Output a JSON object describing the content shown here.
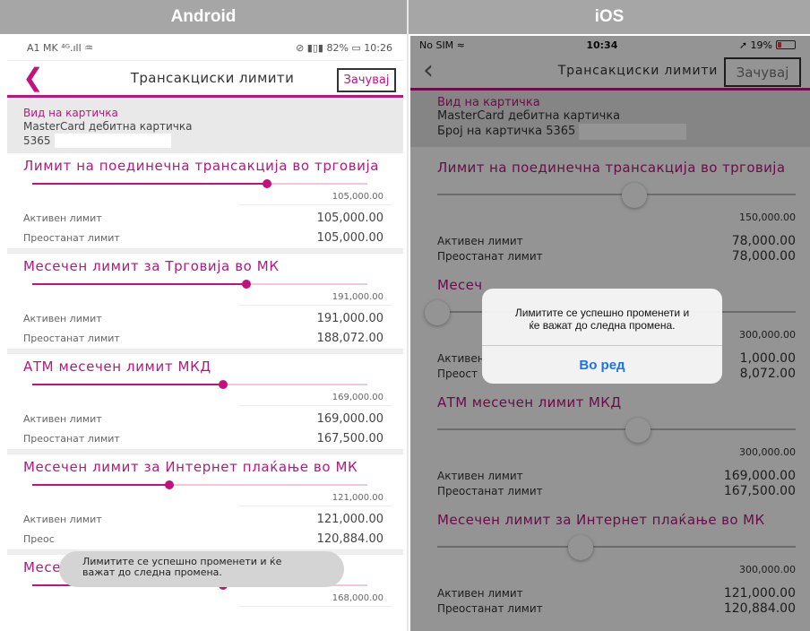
{
  "labels": {
    "android": "Android",
    "ios": "iOS"
  },
  "colors": {
    "accent": "#c2127f",
    "header_bg": "#a6a6a6",
    "ios_link": "#1a73e8"
  },
  "android": {
    "status": {
      "left": "A1 MK ⁴ᴳ.ıll ♒",
      "right": "⊘ ▮▯▮ 82% ▭ 10:26"
    },
    "nav": {
      "back_icon": "chevron-left-icon",
      "title": "Трансакциски лимити",
      "save": "Зачувај"
    },
    "card": {
      "label": "Вид на картичка",
      "type": "MasterCard дебитна картичка",
      "number": "5365"
    },
    "sections": [
      {
        "title": "Лимит на поединечна трансакција во трговија",
        "max": "105,000.00",
        "slider_fraction": 0.7,
        "active_label": "Активен лимит",
        "active": "105,000.00",
        "remaining_label": "Преостанат лимит",
        "remaining": "105,000.00"
      },
      {
        "title": "Месечен лимит за Трговија во МК",
        "max": "191,000.00",
        "slider_fraction": 0.64,
        "active_label": "Активен лимит",
        "active": "191,000.00",
        "remaining_label": "Преостанат лимит",
        "remaining": "188,072.00"
      },
      {
        "title": "АТМ месечен лимит МКД",
        "max": "169,000.00",
        "slider_fraction": 0.57,
        "active_label": "Активен лимит",
        "active": "169,000.00",
        "remaining_label": "Преостанат лимит",
        "remaining": "167,500.00"
      },
      {
        "title": "Месечен лимит за Интернет плаќање во МК",
        "max": "121,000.00",
        "slider_fraction": 0.41,
        "active_label": "Активен лимит",
        "active": "121,000.00",
        "remaining_label": "Преос",
        "remaining": "120,884.00"
      },
      {
        "title": "Месечен лимит за Трговија во странство",
        "max": "168,000.00",
        "slider_fraction": 0.57
      }
    ],
    "toast": {
      "line1": "Лимитите се успешно променети и ќе",
      "line2": "важат до следна промена."
    }
  },
  "ios": {
    "status": {
      "carrier": "No SIM ≈",
      "time": "10:34",
      "battery": "➚ 19%"
    },
    "nav": {
      "back_icon": "chevron-left-icon",
      "title": "Трансакциски лимити",
      "save": "Зачувај"
    },
    "card": {
      "label": "Вид на картичка",
      "type": "MasterCard дебитна картичка",
      "number_label": "Број на картичка 5365"
    },
    "sections": [
      {
        "title": "Лимит на поединечна трансакција во трговија",
        "max": "150,000.00",
        "slider_fraction": 0.55,
        "active_label": "Активен лимит",
        "active": "78,000.00",
        "remaining_label": "Преостанат лимит",
        "remaining": "78,000.00"
      },
      {
        "title": "Месеч",
        "max": "300,000.00",
        "slider_fraction": 0.0,
        "active_label": "Активен",
        "active": "1,000.00",
        "remaining_label": "Преост",
        "remaining": "8,072.00"
      },
      {
        "title": "АТМ месечен лимит МКД",
        "max": "300,000.00",
        "slider_fraction": 0.56,
        "active_label": "Активен лимит",
        "active": "169,000.00",
        "remaining_label": "Преостанат лимит",
        "remaining": "167,500.00"
      },
      {
        "title": "Месечен лимит за Интернет плаќање во МК",
        "max": "300,000.00",
        "slider_fraction": 0.4,
        "active_label": "Активен лимит",
        "active": "121,000.00",
        "remaining_label": "Преостанат лимит",
        "remaining": "120,884.00"
      }
    ],
    "alert": {
      "line1": "Лимитите се успешно променети и",
      "line2": "ќе важат до следна промена.",
      "ok": "Во ред"
    }
  }
}
